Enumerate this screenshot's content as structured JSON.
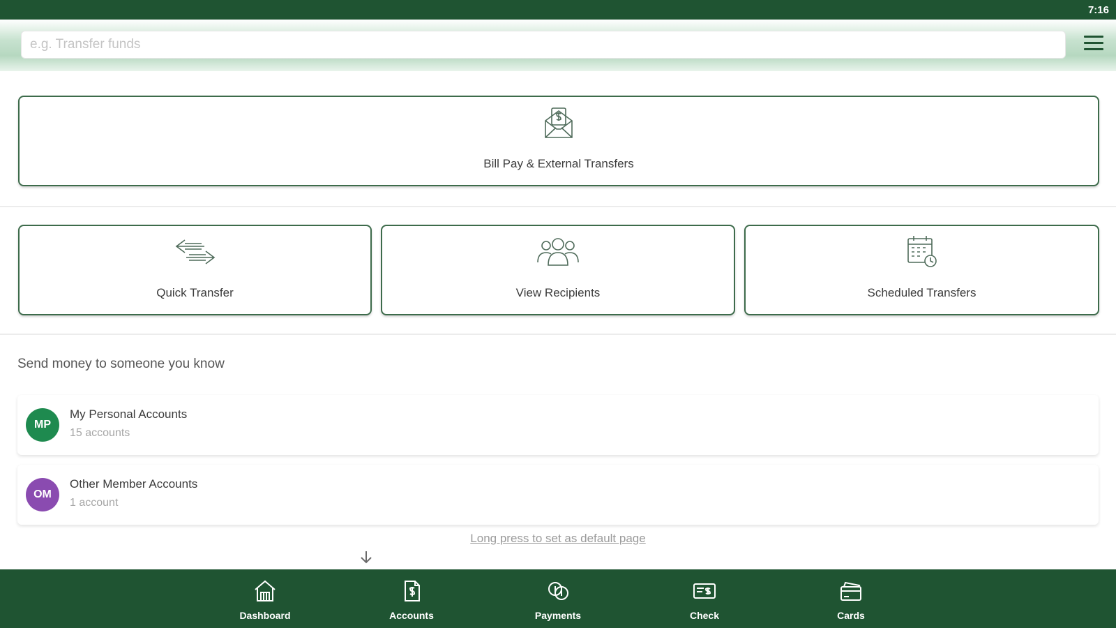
{
  "status_bar": {
    "time": "7:16"
  },
  "search": {
    "placeholder": "e.g. Transfer funds"
  },
  "tiles": {
    "bill_pay": {
      "label": "Bill Pay & External Transfers",
      "icon": "envelope-dollar-icon"
    },
    "quick_transfer": {
      "label": "Quick Transfer",
      "icon": "transfer-arrows-icon"
    },
    "view_recipients": {
      "label": "View Recipients",
      "icon": "people-group-icon"
    },
    "scheduled_transfers": {
      "label": "Scheduled Transfers",
      "icon": "calendar-clock-icon"
    }
  },
  "send_money": {
    "title": "Send money to someone you know",
    "accounts": [
      {
        "initials": "MP",
        "name": "My Personal Accounts",
        "count": "15 accounts",
        "color": "#1e8a4f"
      },
      {
        "initials": "OM",
        "name": "Other Member Accounts",
        "count": "1 account",
        "color": "#8a4bb0"
      }
    ]
  },
  "hint": "Long press to set as default page",
  "bottom_nav": [
    {
      "label": "Dashboard",
      "icon": "home-icon"
    },
    {
      "label": "Accounts",
      "icon": "document-dollar-icon"
    },
    {
      "label": "Payments",
      "icon": "payments-icon"
    },
    {
      "label": "Check",
      "icon": "check-icon"
    },
    {
      "label": "Cards",
      "icon": "card-icon"
    }
  ],
  "colors": {
    "brand": "#1f5432",
    "tile_border": "#3d6b4b"
  }
}
